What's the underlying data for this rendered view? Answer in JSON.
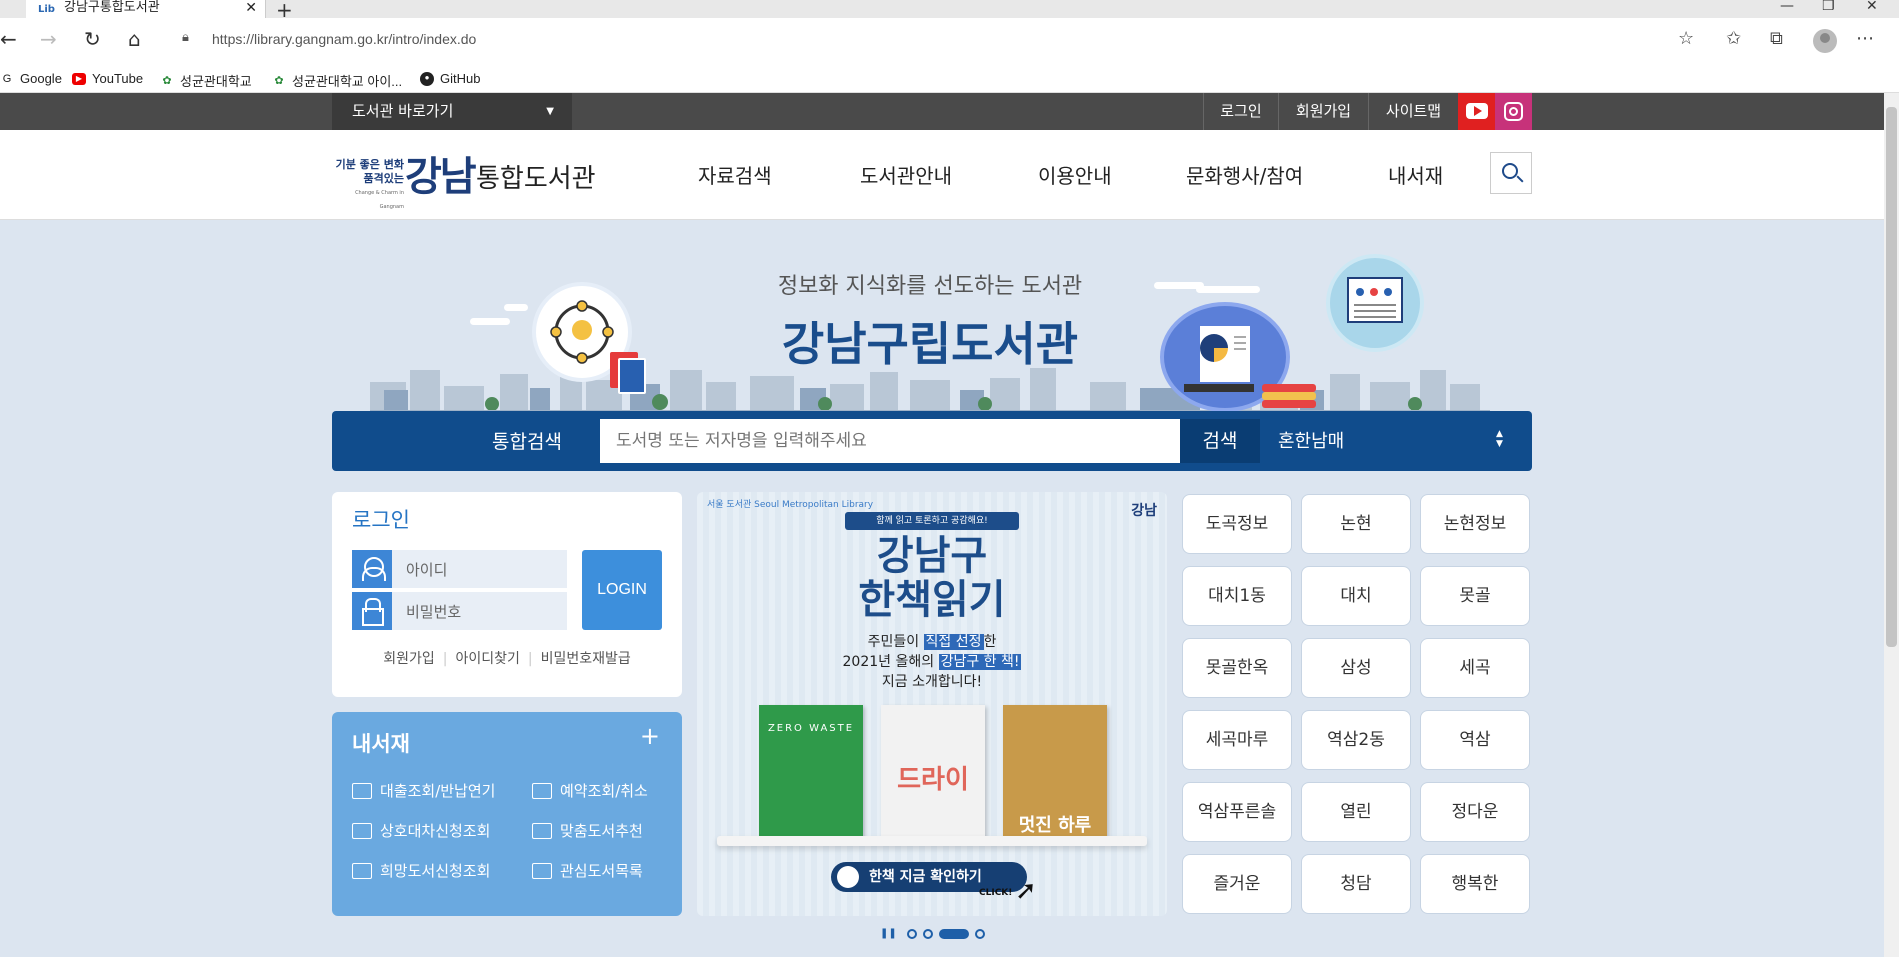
{
  "browser": {
    "tab_title": "강남구통합도서관",
    "tab_favicon": "Lib",
    "url": "https://library.gangnam.go.kr/intro/index.do",
    "bookmarks": [
      "Google",
      "YouTube",
      "성균관대학교",
      "성균관대학교 아이...",
      "GitHub"
    ]
  },
  "topbar": {
    "quick_menu": "도서관 바로가기",
    "links": [
      "로그인",
      "회원가입",
      "사이트맵"
    ],
    "sns": [
      "youtube-icon",
      "instagram-icon"
    ]
  },
  "header": {
    "logo_small_1": "기분 좋은 변화",
    "logo_small_2": "품격있는",
    "logo_small_eng": "Change & Charm in Gangnam",
    "logo_big": "강남",
    "site_name": "통합도서관",
    "nav": [
      "자료검색",
      "도서관안내",
      "이용안내",
      "문화행사/참여",
      "내서재"
    ]
  },
  "hero": {
    "subtitle": "정보화 지식화를 선도하는 도서관",
    "title": "강남구립도서관"
  },
  "search": {
    "label": "통합검색",
    "placeholder": "도서명 또는 저자명을 입력해주세요",
    "button": "검색",
    "library_select": "혼한남매"
  },
  "login": {
    "title": "로그인",
    "id_placeholder": "아이디",
    "pw_placeholder": "비밀번호",
    "button": "LOGIN",
    "links": [
      "회원가입",
      "아이디찾기",
      "비밀번호재발급"
    ]
  },
  "mylib": {
    "title": "내서재",
    "plus": "+",
    "items": [
      "대출조회/반납연기",
      "예약조회/취소",
      "상호대차신청조회",
      "맞춤도서추천",
      "희망도서신청조회",
      "관심도서목록"
    ]
  },
  "banner": {
    "top_left": "서울 도서관 Seoul Metropolitan Library",
    "top_right": "강남",
    "ribbon": "함께 읽고 토론하고 공감해요!",
    "title_line1": "강남구",
    "title_line2": "한책읽기",
    "desc_line1_a": "주민들이 ",
    "desc_line1_hl": "직접 선정",
    "desc_line1_b": "한",
    "desc_line2_a": "2021년 올해의 ",
    "desc_line2_hl": "강남구 한 책!",
    "desc_line3": "지금 소개합니다!",
    "book1": "ZERO WASTE",
    "book2": "드라이",
    "book3": "멋진 하루",
    "cta": "한책 지금 확인하기",
    "click": "CLICK!"
  },
  "branches": [
    "도곡정보",
    "논현",
    "논현정보",
    "대치1동",
    "대치",
    "못골",
    "못골한옥",
    "삼성",
    "세곡",
    "세곡마루",
    "역삼2동",
    "역삼",
    "역삼푸른솔",
    "열린",
    "정다운",
    "즐거운",
    "청담",
    "행복한"
  ]
}
